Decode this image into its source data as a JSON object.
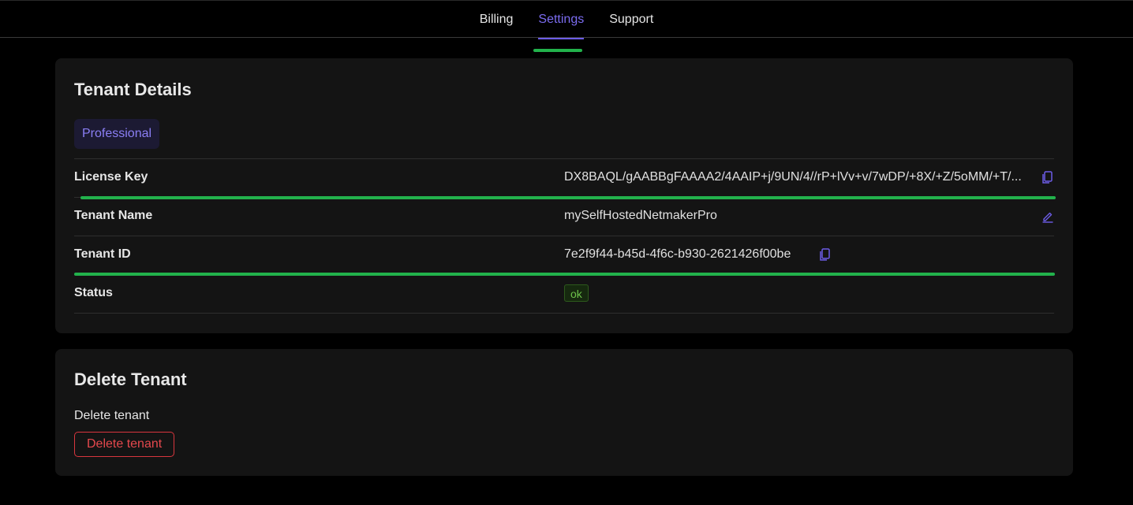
{
  "nav": {
    "tabs": [
      {
        "label": "Billing"
      },
      {
        "label": "Settings"
      },
      {
        "label": "Support"
      }
    ],
    "active_tab": "Settings"
  },
  "tenant_details": {
    "title": "Tenant Details",
    "plan_badge": "Professional",
    "rows": {
      "license_key": {
        "label": "License Key",
        "value": "DX8BAQL/gAABBgFAAAA2/4AAIP+j/9UN/4//rP+lVv+v/7wDP/+8X/+Z/5oMM/+T/..."
      },
      "tenant_name": {
        "label": "Tenant Name",
        "value": "mySelfHostedNetmakerPro"
      },
      "tenant_id": {
        "label": "Tenant ID",
        "value": "7e2f9f44-b45d-4f6c-b930-2621426f00be"
      },
      "status": {
        "label": "Status",
        "value": "ok"
      }
    }
  },
  "delete_tenant": {
    "title": "Delete Tenant",
    "description": "Delete tenant",
    "button_label": "Delete tenant"
  },
  "icons": {
    "copy": "copy-icon",
    "edit": "edit-icon"
  },
  "colors": {
    "accent": "#6c5ce7",
    "highlight": "#22b24c",
    "danger": "#e5484d",
    "status_ok": "#6cc24a",
    "card_bg": "#141414",
    "page_bg": "#000000"
  }
}
